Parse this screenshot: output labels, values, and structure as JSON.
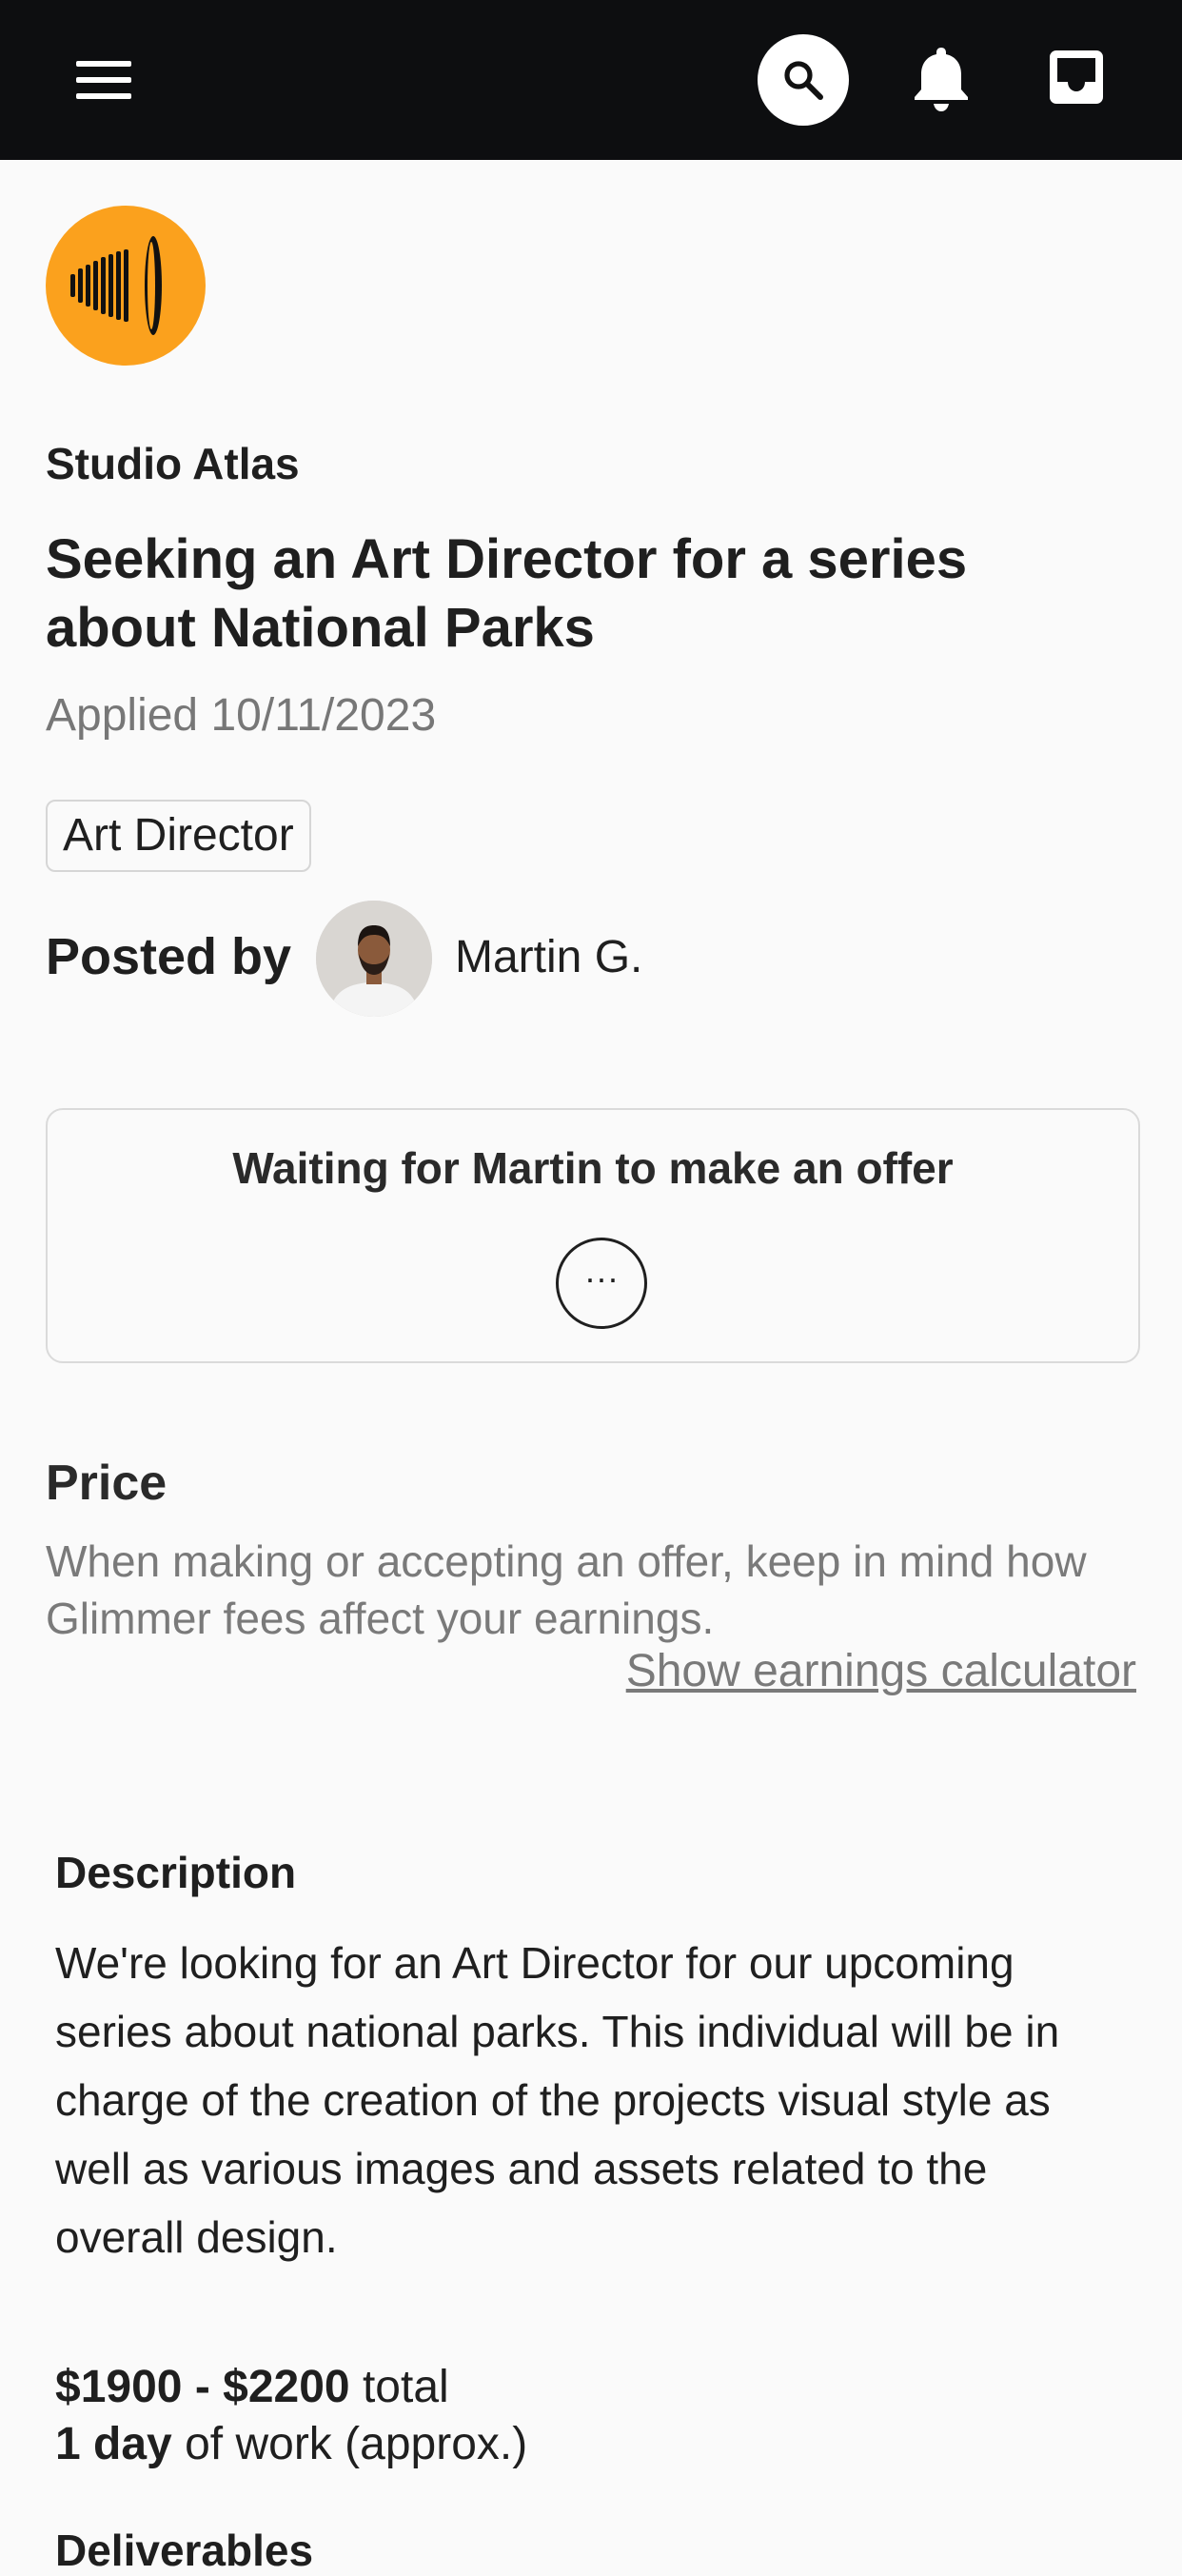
{
  "header": {
    "menu_icon": "hamburger-menu-icon",
    "search_icon": "search-icon",
    "notifications_icon": "bell-icon",
    "inbox_icon": "inbox-icon"
  },
  "colors": {
    "topbar_bg": "#0d0e10",
    "logo_bg": "#fba11d",
    "page_bg": "#fafafa"
  },
  "job": {
    "company": "Studio Atlas",
    "title": "Seeking an Art Director for a series about National Parks",
    "applied": "Applied 10/11/2023",
    "tag": "Art Director"
  },
  "poster": {
    "label": "Posted by",
    "name": "Martin G."
  },
  "offer": {
    "status": "Waiting for Martin to make an offer",
    "more_label": "···"
  },
  "price": {
    "heading": "Price",
    "note": "When making or accepting an offer, keep in mind how Glimmer fees affect your earnings.",
    "calculator_link": "Show earnings calculator"
  },
  "description": {
    "heading": "Description",
    "body": "We're looking for an Art Director for our upcoming series about national parks. This individual will be in charge of the creation of the projects visual style as well as various images and assets related to the overall design."
  },
  "terms": {
    "budget_value": "$1900 - $2200",
    "budget_suffix": " total",
    "duration_value": "1 day",
    "duration_suffix": " of work (approx.)"
  },
  "deliverables": {
    "heading": "Deliverables"
  }
}
